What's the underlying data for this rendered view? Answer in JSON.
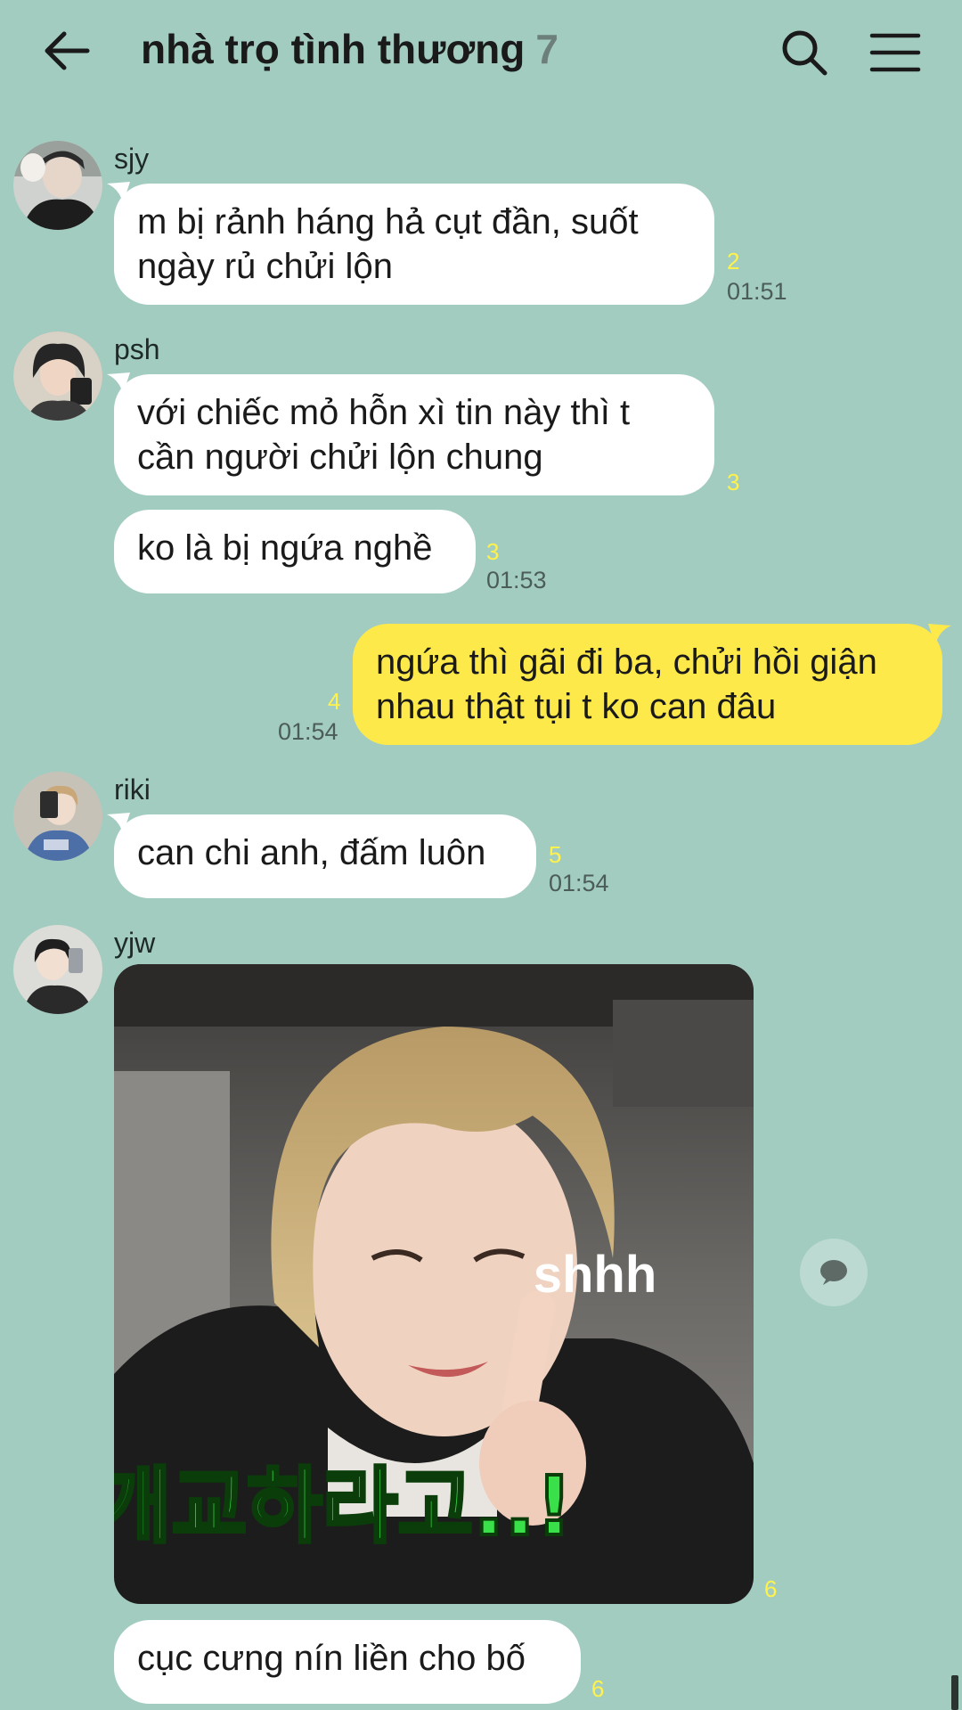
{
  "header": {
    "title": "nhà trọ tình thương",
    "member_count": "7",
    "back_icon": "arrow-left-icon",
    "search_icon": "search-icon",
    "menu_icon": "hamburger-menu-icon"
  },
  "colors": {
    "background": "#a3ccc1",
    "incoming_bubble": "#ffffff",
    "outgoing_bubble": "#fee94b",
    "unread_count": "#fff24a",
    "time": "#4c5d59"
  },
  "messages": [
    {
      "sender": "sjy",
      "text": "m bị rảnh háng hả cụt đần, suốt ngày rủ chửi lộn",
      "unread": "2",
      "time": "01:51"
    },
    {
      "sender": "psh",
      "text": "với chiếc mỏ hỗn xì tin này thì t cần người chửi lộn chung",
      "unread": "3",
      "time": ""
    },
    {
      "sender": "psh",
      "text": "ko là bị ngứa nghề",
      "unread": "3",
      "time": "01:53"
    },
    {
      "sender": "me",
      "text": "ngứa thì gãi đi ba, chửi hồi giận nhau thật tụi t ko can đâu",
      "unread": "4",
      "time": "01:54"
    },
    {
      "sender": "riki",
      "text": "can chi anh, đấm luôn",
      "unread": "5",
      "time": "01:54"
    },
    {
      "sender": "yjw",
      "type": "image",
      "image_caption": "shhh",
      "image_subtitle": "개교하라고..!",
      "unread": "6",
      "time": ""
    },
    {
      "sender": "yjw",
      "text": "cục cưng nín liền cho bố",
      "unread": "6",
      "time": ""
    }
  ],
  "share_icon": "chat-bubble-icon"
}
